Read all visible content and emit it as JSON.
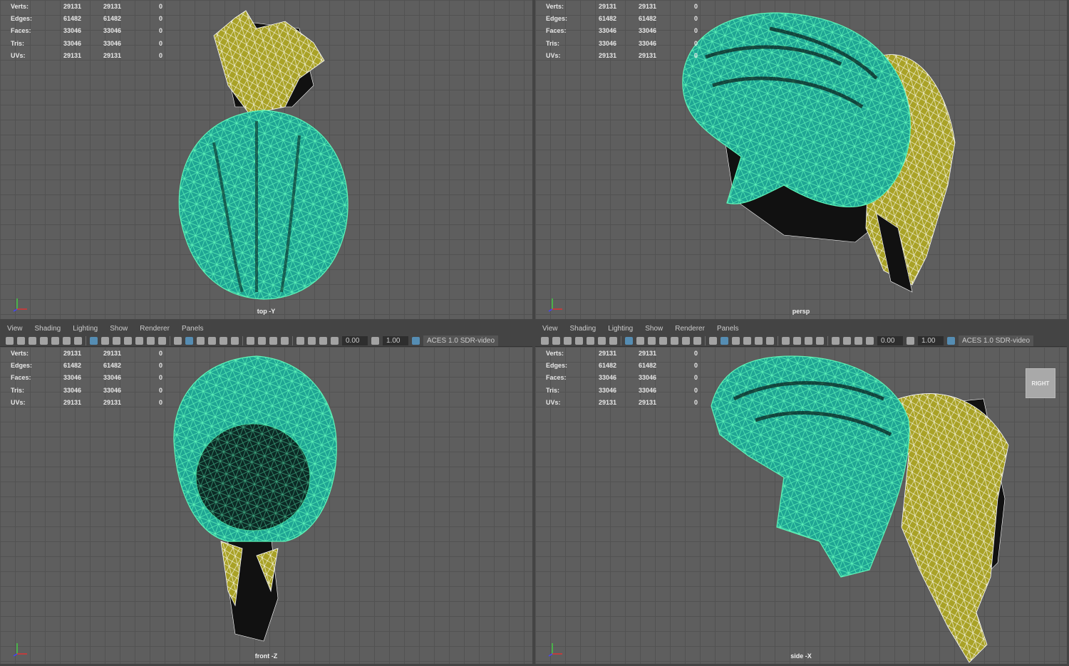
{
  "menus": [
    "View",
    "Shading",
    "Lighting",
    "Show",
    "Renderer",
    "Panels"
  ],
  "toolbar": {
    "exposure": "0.00",
    "gamma": "1.00",
    "color_space": "ACES 1.0 SDR-video"
  },
  "stats_rows": [
    {
      "label": "Verts:",
      "a": "29131",
      "b": "29131",
      "c": "0"
    },
    {
      "label": "Edges:",
      "a": "61482",
      "b": "61482",
      "c": "0"
    },
    {
      "label": "Faces:",
      "a": "33046",
      "b": "33046",
      "c": "0"
    },
    {
      "label": "Tris:",
      "a": "33046",
      "b": "33046",
      "c": "0"
    },
    {
      "label": "UVs:",
      "a": "29131",
      "b": "29131",
      "c": "0"
    }
  ],
  "panes": [
    {
      "id": "top",
      "camera": "top -Y",
      "has_menu": false
    },
    {
      "id": "persp",
      "camera": "persp",
      "has_menu": false
    },
    {
      "id": "front",
      "camera": "front -Z",
      "has_menu": true
    },
    {
      "id": "side",
      "camera": "side -X",
      "has_menu": true,
      "viewcube": "RIGHT"
    }
  ],
  "colors": {
    "teal": "#1fa594",
    "wire": "#5ef5b8",
    "olive": "#a9a226",
    "bg": "#5e5e5e"
  }
}
